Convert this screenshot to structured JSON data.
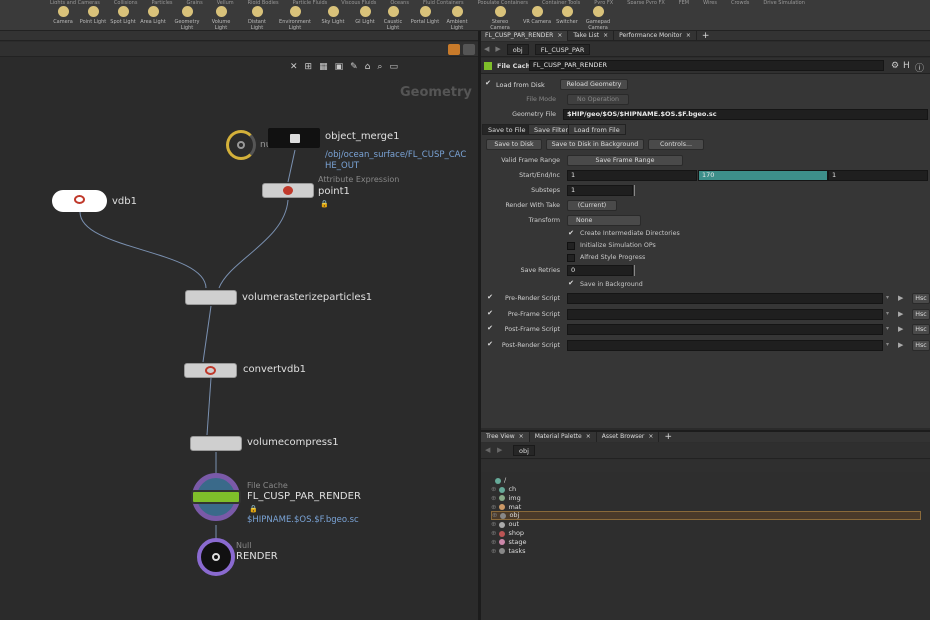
{
  "shelf": {
    "tabs": [
      "Lights and Cameras",
      "Collisions",
      "Particles",
      "Grains",
      "Vellum",
      "Rigid Bodies",
      "Particle Fluids",
      "Viscous Fluids",
      "Oceans",
      "Fluid Containers",
      "Populate Containers",
      "Container Tools",
      "Pyro FX",
      "Sparse Pyro FX",
      "FEM",
      "Wires",
      "Crowds",
      "Drive Simulation"
    ],
    "tools": [
      "Camera",
      "Point Light",
      "Spot Light",
      "Area Light",
      "Geometry Light",
      "Volume Light",
      "Distant Light",
      "Environment Light",
      "Sky Light",
      "GI Light",
      "Caustic Light",
      "Portal Light",
      "Ambient Light",
      "Stereo Camera",
      "VR Camera",
      "Switcher",
      "Gamepad Camera"
    ]
  },
  "right_tabs": [
    "FL_CUSP_PAR_RENDER",
    "Take List",
    "Performance Monitor"
  ],
  "param_path": {
    "context": "obj",
    "node": "FL_CUSP_PAR"
  },
  "network": {
    "title": "Geometry",
    "nodes": {
      "object_merge": {
        "name": "object_merge1",
        "path": "/obj/ocean_surface/FL_CUSP_CACHE_OUT",
        "path_line1": "/obj/ocean_surface/FL_CUSP_CAC",
        "path_line2": "HE_OUT",
        "partial": "nu"
      },
      "point": {
        "name": "point1",
        "sub": "Attribute Expression"
      },
      "vdb": {
        "name": "vdb1"
      },
      "rasterize": {
        "name": "volumerasterizeparticles1"
      },
      "convertvdb": {
        "name": "convertvdb1"
      },
      "compress": {
        "name": "volumecompress1"
      },
      "filecache": {
        "type": "File Cache",
        "name": "FL_CUSP_PAR_RENDER",
        "path": "$HIPNAME.$OS.$F.bgeo.sc"
      },
      "null": {
        "type": "Null",
        "name": "RENDER"
      }
    }
  },
  "params": {
    "node_type": "File Cache",
    "node_name": "FL_CUSP_PAR_RENDER",
    "load_from_disk": "Load from Disk",
    "reload_geometry": "Reload Geometry",
    "file_mode_label": "File Mode",
    "file_mode_value": "No Operation",
    "geometry_file_label": "Geometry File",
    "geometry_file_value": "$HIP/geo/$OS/$HIPNAME.$OS.$F.bgeo.sc",
    "tabs": [
      "Save to File",
      "Save Filter",
      "Load from File"
    ],
    "save_to_disk": "Save to Disk",
    "save_background": "Save to Disk in Background",
    "controls": "Controls...",
    "valid_frame_label": "Valid Frame Range",
    "valid_frame_value": "Save Frame Range",
    "start_end_label": "Start/End/Inc",
    "start": "1",
    "end": "170",
    "inc": "1",
    "substeps_label": "Substeps",
    "substeps": "1",
    "render_take_label": "Render With Take",
    "render_take_value": "(Current)",
    "transform_label": "Transform",
    "transform_value": "None",
    "create_dirs": "Create Intermediate Directories",
    "init_sim": "Initialize Simulation OPs",
    "alfred": "Alfred Style Progress",
    "save_retries_label": "Save Retries",
    "save_retries": "0",
    "save_bg": "Save in Background",
    "scripts": [
      "Pre-Render Script",
      "Pre-Frame Script",
      "Post-Frame Script",
      "Post-Render Script"
    ],
    "script_lang": "Hsc"
  },
  "tree": {
    "tabs": [
      "Tree View",
      "Material Palette",
      "Asset Browser"
    ],
    "path": "obj",
    "root": "/",
    "items": [
      "ch",
      "img",
      "mat",
      "obj",
      "out",
      "shop",
      "stage",
      "tasks"
    ],
    "selected": "obj"
  },
  "colors": {
    "accent_teal": "#3d8f8a",
    "path_blue": "#7aa3d6",
    "filecache_purple": "#7a5aa8",
    "filecache_green": "#7fbf2a"
  }
}
